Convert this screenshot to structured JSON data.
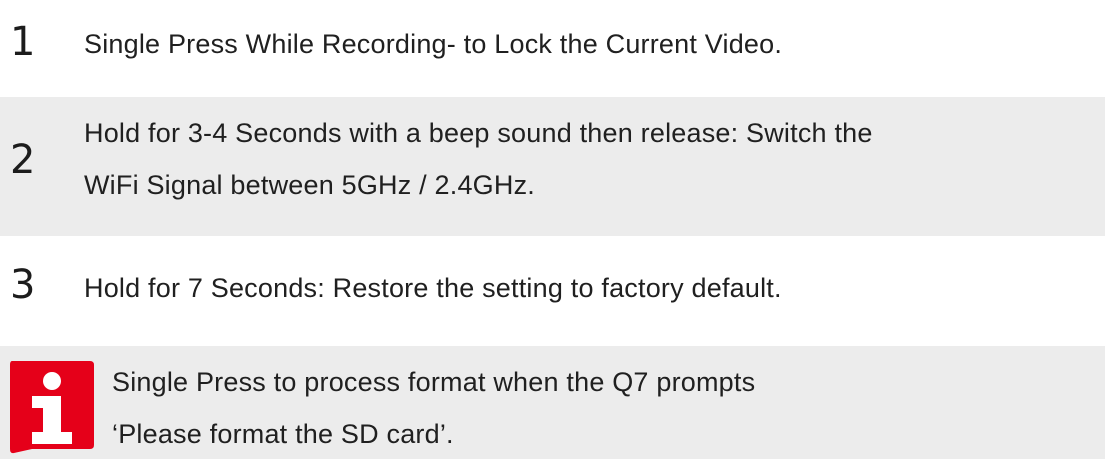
{
  "steps": [
    {
      "number": "1",
      "lines": [
        "Single Press While Recording- to Lock the Current Video."
      ]
    },
    {
      "number": "2",
      "lines": [
        "Hold for 3-4 Seconds with a beep sound then release: Switch the",
        "WiFi Signal between 5GHz / 2.4GHz."
      ]
    },
    {
      "number": "3",
      "lines": [
        "Hold for 7 Seconds: Restore the setting to factory default."
      ]
    }
  ],
  "note": {
    "icon": "info-icon",
    "lines": [
      "Single Press to process format when the Q7 prompts",
      "‘Please format the SD card’."
    ]
  },
  "colors": {
    "shaded_row": "#ececec",
    "icon_red": "#e50019",
    "text": "#202020"
  }
}
